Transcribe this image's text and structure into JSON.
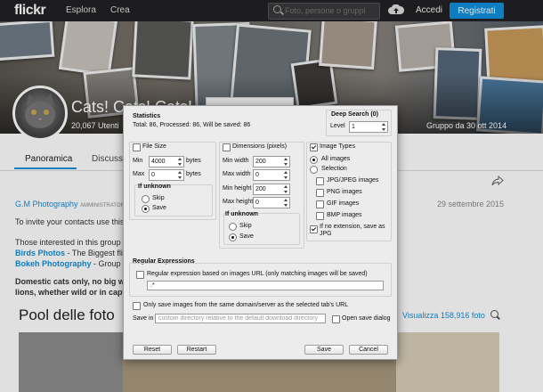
{
  "topbar": {
    "logo": "flickr",
    "nav": [
      "Esplora",
      "Crea"
    ],
    "search_placeholder": "Foto, persone o gruppi",
    "login": "Accedi",
    "register": "Registrati"
  },
  "group": {
    "title": "Cats! Cats! Cats!",
    "members": "20,067 Utenti",
    "created": "Gruppo da 30 ott 2014"
  },
  "tabs": [
    "Panoramica",
    "Discussio"
  ],
  "post": {
    "author": "G.M Photography",
    "role": "AMMINISTRATORE",
    "date": "29 settembre 2015",
    "invite": "To invite your contacts use this",
    "interested": "Those interested in this group m",
    "birds_link": "Birds Photos",
    "birds_rest": " - The Biggest flick",
    "bokeh_link": "Bokeh Photography",
    "bokeh_rest": " - Group fo",
    "rule1": "Domestic cats only, no big wild",
    "rule2": "lions, whether wild or in captiv"
  },
  "pool": {
    "title": "Pool delle foto",
    "view_link": "Visualizza 158,916 foto"
  },
  "dialog": {
    "statistics_title": "Statistics",
    "statistics_text": "Total: 86, Processed: 86, Will be saved: 86",
    "deep_search_title": "Deep Search (0)",
    "level_label": "Level",
    "level_value": "1",
    "file_size": {
      "label": "File Size",
      "min_label": "Min",
      "min_value": "4000",
      "min_unit": "bytes",
      "max_label": "Max",
      "max_value": "0",
      "max_unit": "bytes",
      "unknown_title": "If unknown",
      "skip": "Skip",
      "save": "Save"
    },
    "dimensions": {
      "label": "Dimensions (pixels)",
      "min_width_label": "Min width",
      "min_width": "200",
      "max_width_label": "Max width",
      "max_width": "0",
      "min_height_label": "Min height",
      "min_height": "200",
      "max_height_label": "Max height",
      "max_height": "0",
      "unknown_title": "If unknown",
      "skip": "Skip",
      "save": "Save"
    },
    "image_types": {
      "label": "Image Types",
      "all": "All images",
      "selection": "Selection",
      "jpg": "JPG/JPEG images",
      "png": "PNG images",
      "gif": "GIF images",
      "bmp": "BMP images",
      "noext_line1": "If no extension, save as",
      "noext_line2": "JPG"
    },
    "regex": {
      "title": "Regular Expressions",
      "checkbox_label": "Regular expression based on images URL (only matching images will be saved)",
      "value": ".*"
    },
    "same_domain": "Only save images from the same domain/server as the selected tab's URL",
    "save_in_label": "Save in",
    "save_in_placeholder": "custom directory relative to the default download directory",
    "open_save_dialog": "Open save dialog",
    "buttons": {
      "reset": "Reset",
      "restart": "Restart",
      "save": "Save",
      "cancel": "Cancel"
    }
  }
}
